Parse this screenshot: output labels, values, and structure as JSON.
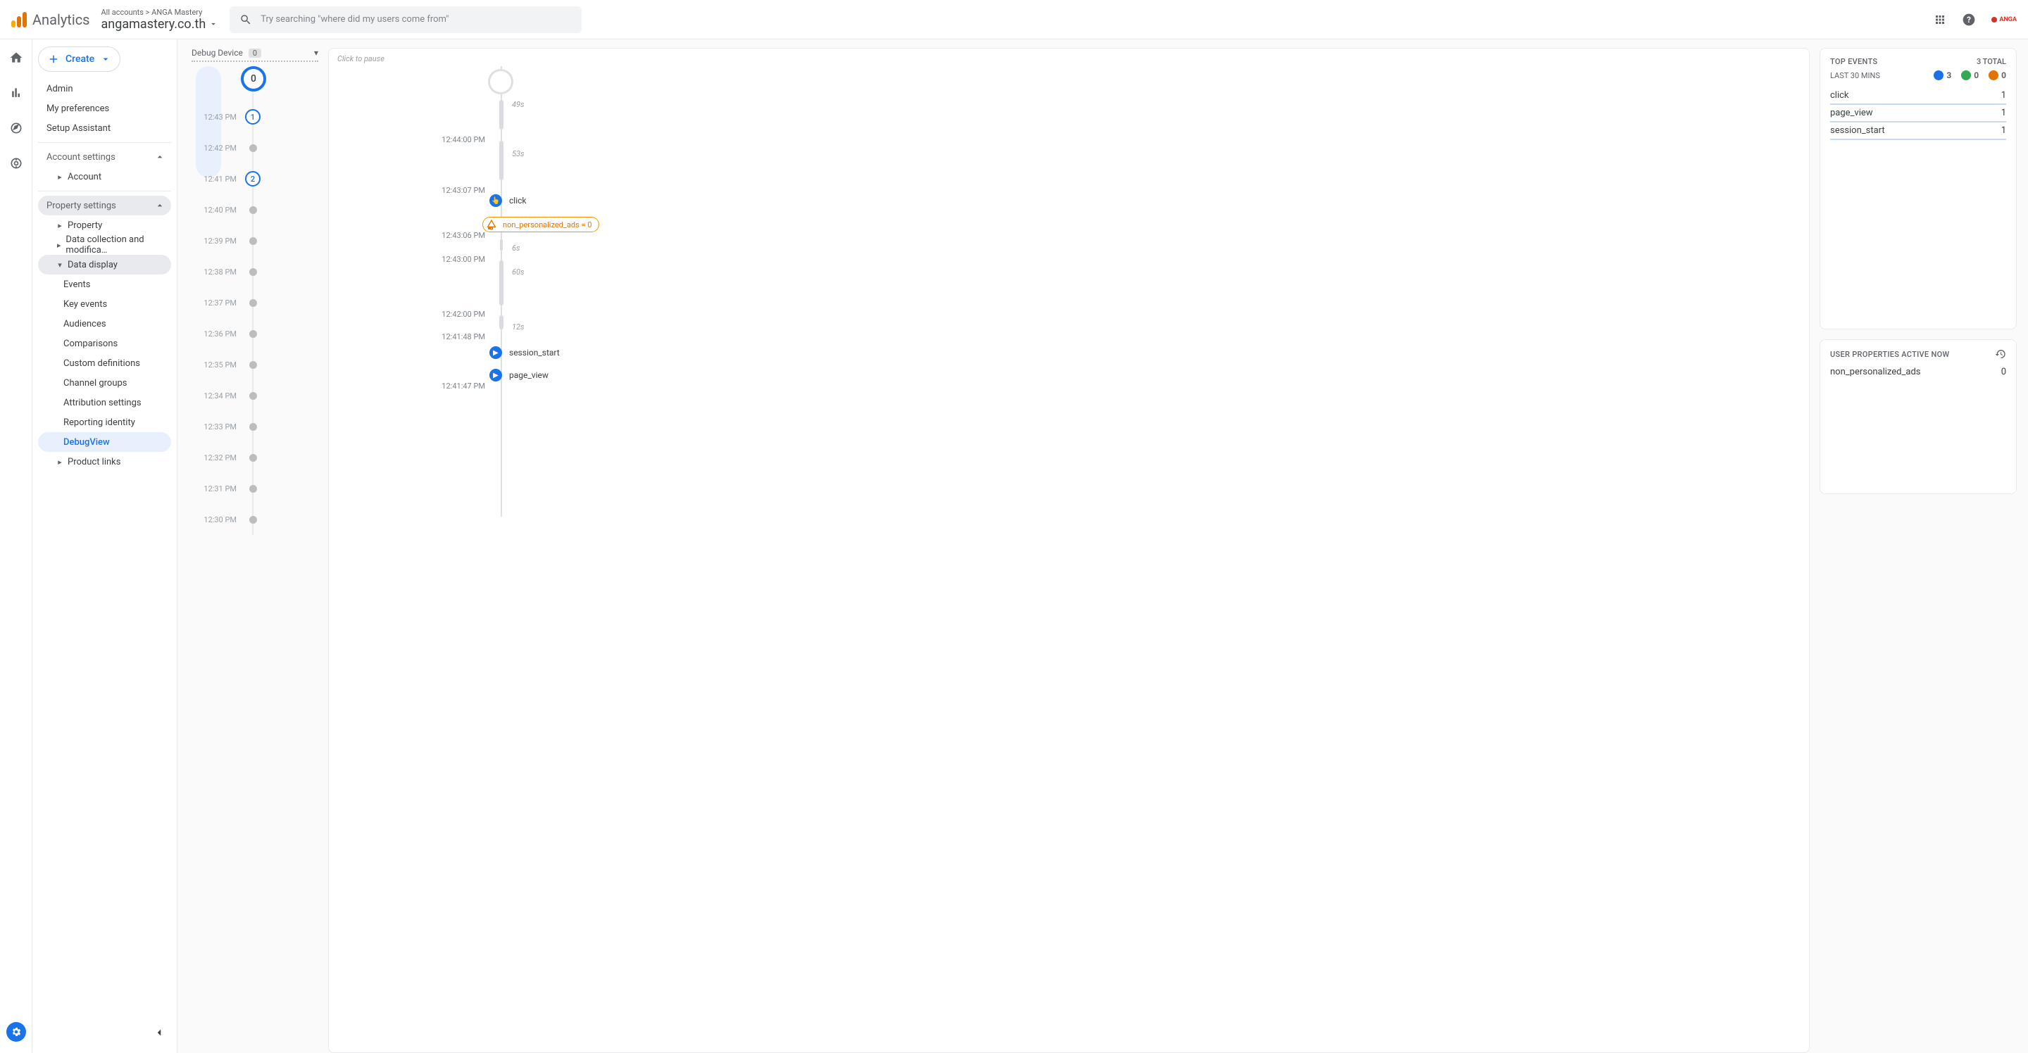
{
  "header": {
    "product": "Analytics",
    "breadcrumb_parent": "All accounts",
    "breadcrumb_child": "ANGA Mastery",
    "property": "angamastery.co.th",
    "search_placeholder": "Try searching \"where did my users come from\"",
    "brand_chip": "ANGA"
  },
  "sidebar": {
    "create": "Create",
    "items": {
      "admin": "Admin",
      "prefs": "My preferences",
      "setup": "Setup Assistant",
      "account_settings": "Account settings",
      "account": "Account",
      "property_settings": "Property settings",
      "property": "Property",
      "data_collection": "Data collection and modifica…",
      "data_display": "Data display",
      "events": "Events",
      "key_events": "Key events",
      "audiences": "Audiences",
      "comparisons": "Comparisons",
      "custom_defs": "Custom definitions",
      "channel_groups": "Channel groups",
      "attribution": "Attribution settings",
      "reporting_identity": "Reporting identity",
      "debugview": "DebugView",
      "product_links": "Product links"
    }
  },
  "debug_device": {
    "label": "Debug Device",
    "count": "0"
  },
  "minutes": {
    "big": "0",
    "rows": [
      {
        "t": "12:43 PM",
        "badge": "1"
      },
      {
        "t": "12:42 PM"
      },
      {
        "t": "12:41 PM",
        "badge": "2"
      },
      {
        "t": "12:40 PM"
      },
      {
        "t": "12:39 PM"
      },
      {
        "t": "12:38 PM"
      },
      {
        "t": "12:37 PM"
      },
      {
        "t": "12:36 PM"
      },
      {
        "t": "12:35 PM"
      },
      {
        "t": "12:34 PM"
      },
      {
        "t": "12:33 PM"
      },
      {
        "t": "12:32 PM"
      },
      {
        "t": "12:31 PM"
      },
      {
        "t": "12:30 PM"
      }
    ]
  },
  "stream": {
    "pause_hint": "Click to pause",
    "ticks": {
      "t1": "12:44:00 PM",
      "t2": "12:43:07 PM",
      "t3": "12:43:06 PM",
      "t4": "12:43:00 PM",
      "t5": "12:42:00 PM",
      "t6": "12:41:48 PM",
      "t7": "12:41:47 PM"
    },
    "gaps": {
      "g1": "49s",
      "g2": "53s",
      "g3": "6s",
      "g4": "60s",
      "g5": "12s"
    },
    "events": {
      "e1": "click",
      "e2": "session_start",
      "e3": "page_view"
    },
    "flag": "non_personalized_ads = 0"
  },
  "top_events": {
    "title": "TOP EVENTS",
    "total": "3 TOTAL",
    "subtitle": "LAST 30 MINS",
    "legend": {
      "blue": "3",
      "green": "0",
      "orange": "0"
    },
    "rows": [
      {
        "name": "click",
        "count": "1"
      },
      {
        "name": "page_view",
        "count": "1"
      },
      {
        "name": "session_start",
        "count": "1"
      }
    ]
  },
  "user_props": {
    "title": "USER PROPERTIES ACTIVE NOW",
    "rows": [
      {
        "name": "non_personalized_ads",
        "value": "0"
      }
    ]
  }
}
